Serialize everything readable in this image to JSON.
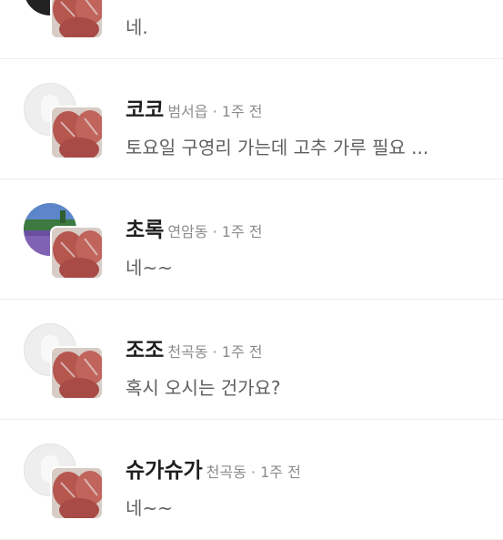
{
  "chats": [
    {
      "name": "",
      "location": "",
      "time": "",
      "message": "네.",
      "avatar": "dark"
    },
    {
      "name": "코코",
      "location": "범서읍",
      "time": "1주 전",
      "message": "토요일 구영리 가는데 고추 가루 필요 ...",
      "avatar": "default"
    },
    {
      "name": "초록",
      "location": "연암동",
      "time": "1주 전",
      "message": "네~~",
      "avatar": "photo"
    },
    {
      "name": "조조",
      "location": "천곡동",
      "time": "1주 전",
      "message": "혹시 오시는 건가요?",
      "avatar": "default"
    },
    {
      "name": "슈가슈가",
      "location": "천곡동",
      "time": "1주 전",
      "message": "네~~",
      "avatar": "default"
    }
  ],
  "separator": "·"
}
